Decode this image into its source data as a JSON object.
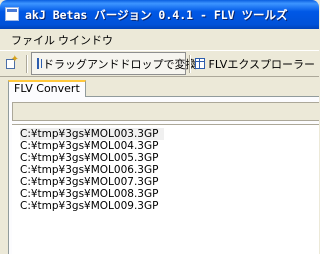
{
  "window": {
    "title": "akJ Betas バージョン 0.4.1 - FLV ツールズ"
  },
  "menu": {
    "items": [
      "ファイル",
      "ウインドウ"
    ]
  },
  "toolbar": {
    "buttons": [
      {
        "label": "ドラッグアンドドロップで変換",
        "active": true
      },
      {
        "label": "FLVエクスプローラー",
        "active": false
      }
    ]
  },
  "tabs": [
    {
      "label": "FLV Convert",
      "selected": true
    }
  ],
  "files": [
    "C:¥tmp¥3gs¥MOL003.3GP",
    "C:¥tmp¥3gs¥MOL004.3GP",
    "C:¥tmp¥3gs¥MOL005.3GP",
    "C:¥tmp¥3gs¥MOL006.3GP",
    "C:¥tmp¥3gs¥MOL007.3GP",
    "C:¥tmp¥3gs¥MOL008.3GP",
    "C:¥tmp¥3gs¥MOL009.3GP"
  ],
  "colors": {
    "titlebar": "#0058E6",
    "tab_highlight": "#FFC83C",
    "window_bg": "#ECE9D8"
  }
}
